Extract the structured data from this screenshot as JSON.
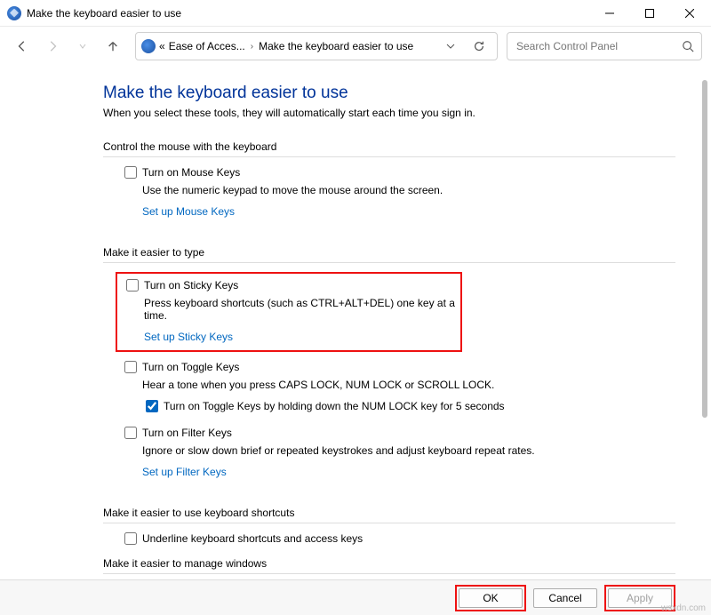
{
  "window": {
    "title": "Make the keyboard easier to use"
  },
  "breadcrumb": {
    "prefix": "«",
    "item1": "Ease of Acces...",
    "item2": "Make the keyboard easier to use"
  },
  "search": {
    "placeholder": "Search Control Panel"
  },
  "page": {
    "title": "Make the keyboard easier to use",
    "subtitle": "When you select these tools, they will automatically start each time you sign in."
  },
  "sections": {
    "mouse": {
      "header": "Control the mouse with the keyboard",
      "opt": "Turn on Mouse Keys",
      "desc": "Use the numeric keypad to move the mouse around the screen.",
      "link": "Set up Mouse Keys"
    },
    "type": {
      "header": "Make it easier to type",
      "sticky": {
        "opt": "Turn on Sticky Keys",
        "desc": "Press keyboard shortcuts (such as CTRL+ALT+DEL) one key at a time.",
        "link": "Set up Sticky Keys"
      },
      "toggle": {
        "opt": "Turn on Toggle Keys",
        "desc": "Hear a tone when you press CAPS LOCK, NUM LOCK or SCROLL LOCK.",
        "sub": "Turn on Toggle Keys by holding down the NUM LOCK key for 5 seconds"
      },
      "filter": {
        "opt": "Turn on Filter Keys",
        "desc": "Ignore or slow down brief or repeated keystrokes and adjust keyboard repeat rates.",
        "link": "Set up Filter Keys"
      }
    },
    "shortcuts": {
      "header": "Make it easier to use keyboard shortcuts",
      "opt": "Underline keyboard shortcuts and access keys"
    },
    "windows": {
      "header": "Make it easier to manage windows"
    }
  },
  "buttons": {
    "ok": "OK",
    "cancel": "Cancel",
    "apply": "Apply"
  },
  "watermark": "wsxdn.com"
}
